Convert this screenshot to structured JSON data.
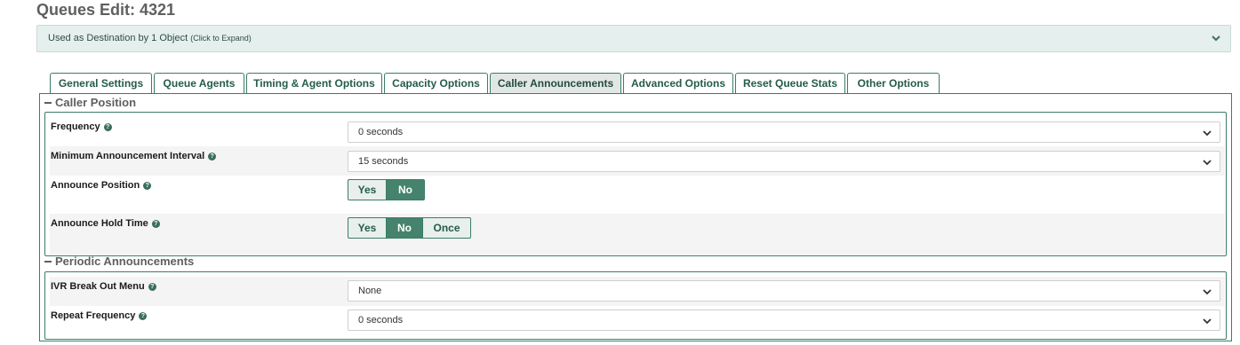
{
  "page": {
    "title": "Queues Edit: 4321"
  },
  "destination": {
    "text": "Used as Destination by 1 Object",
    "hint": "(Click to Expand)"
  },
  "tabs": [
    {
      "label": "General Settings"
    },
    {
      "label": "Queue Agents"
    },
    {
      "label": "Timing & Agent Options"
    },
    {
      "label": "Capacity Options"
    },
    {
      "label": "Caller Announcements",
      "active": true
    },
    {
      "label": "Advanced Options"
    },
    {
      "label": "Reset Queue Stats"
    },
    {
      "label": "Other Options"
    }
  ],
  "caller_position": {
    "heading": "Caller Position",
    "frequency": {
      "label": "Frequency",
      "value": "0 seconds"
    },
    "min_interval": {
      "label": "Minimum Announcement Interval",
      "value": "15 seconds"
    },
    "announce_position": {
      "label": "Announce Position",
      "options": [
        "Yes",
        "No"
      ],
      "selected": "No"
    },
    "announce_hold_time": {
      "label": "Announce Hold Time",
      "options": [
        "Yes",
        "No",
        "Once"
      ],
      "selected": "No"
    }
  },
  "periodic": {
    "heading": "Periodic Announcements",
    "ivr_menu": {
      "label": "IVR Break Out Menu",
      "value": "None"
    },
    "repeat_frequency": {
      "label": "Repeat Frequency",
      "value": "0 seconds"
    }
  },
  "icons": {
    "help": "question-icon",
    "expand": "chevron-down-icon",
    "select": "chevron-down-icon"
  },
  "colors": {
    "accent": "#3a7d67",
    "selected": "#45836d",
    "banner": "#e5efee"
  }
}
